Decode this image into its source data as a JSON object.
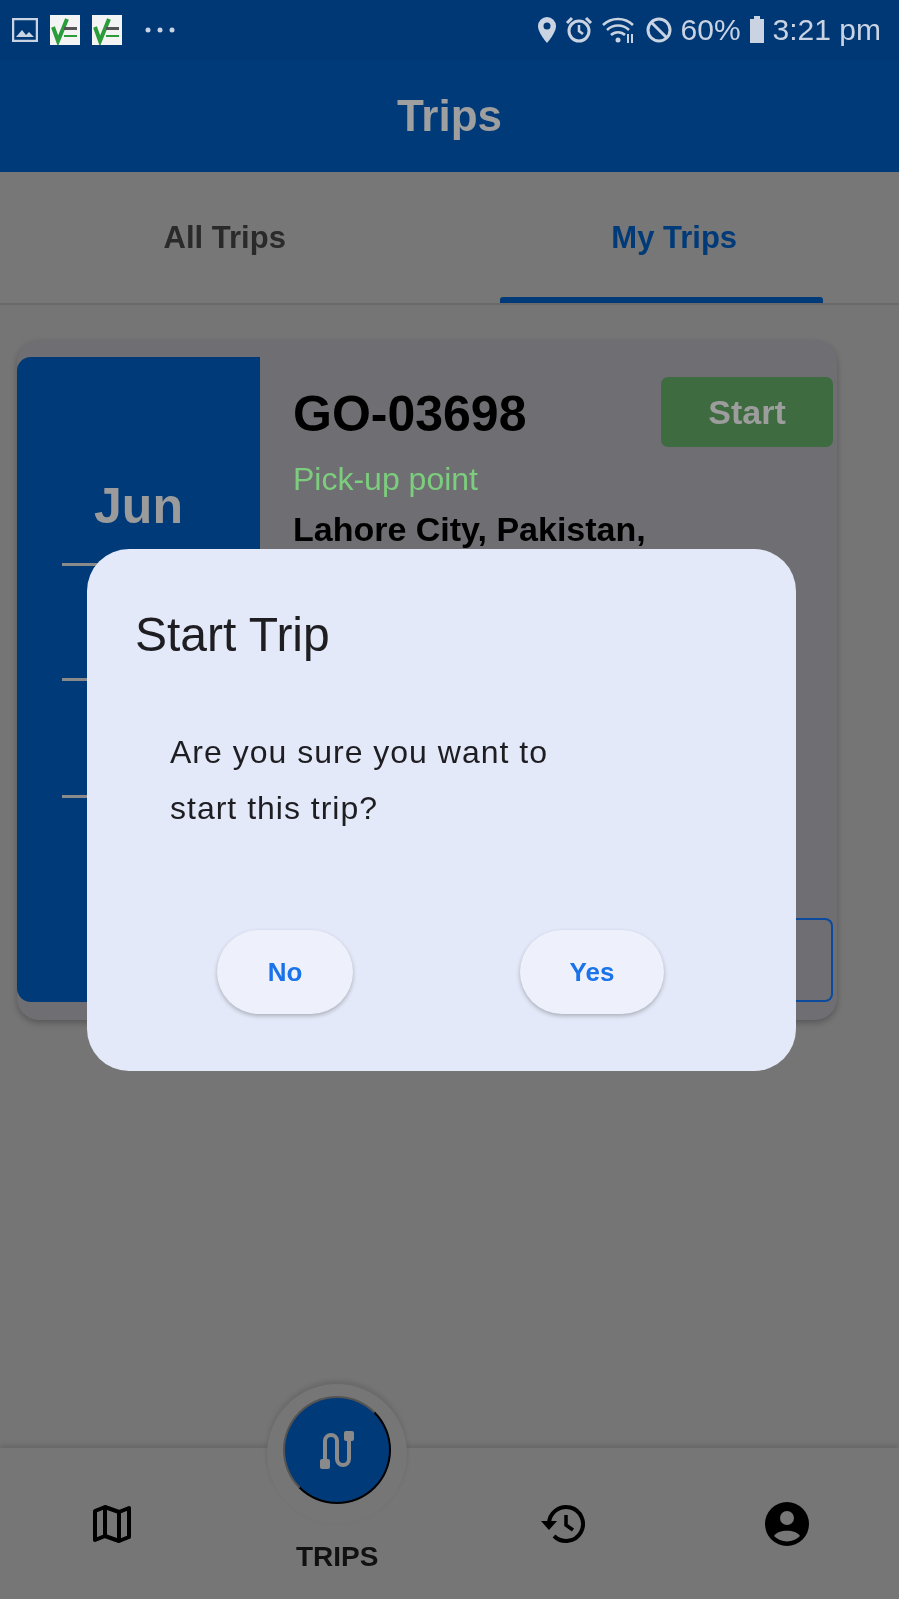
{
  "status_bar": {
    "battery": "60%",
    "time": "3:21 pm"
  },
  "app_bar": {
    "title": "Trips"
  },
  "tabs": [
    {
      "label": "All Trips",
      "selected": false
    },
    {
      "label": "My Trips",
      "selected": true
    }
  ],
  "trip_card": {
    "month": "Jun",
    "trip_id": "GO-03698",
    "start_button": "Start",
    "pickup_label": "Pick-up point",
    "pickup_address": "Lahore City, Pakistan,"
  },
  "dialog": {
    "title": "Start Trip",
    "message": "Are you sure you want to start this trip?",
    "buttons": [
      {
        "label": "No"
      },
      {
        "label": "Yes"
      }
    ]
  },
  "bottom_nav": {
    "items": [
      {
        "kind": "map",
        "selected": false
      },
      {
        "kind": "trips",
        "label": "TRIPS",
        "selected": true
      },
      {
        "kind": "history",
        "selected": false
      },
      {
        "kind": "account",
        "selected": false
      }
    ]
  }
}
